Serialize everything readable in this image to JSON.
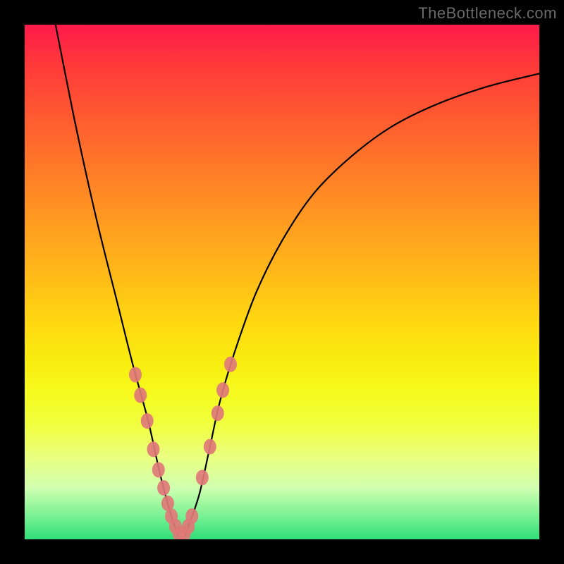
{
  "watermark": "TheBottleneck.com",
  "chart_data": {
    "type": "line",
    "title": "",
    "xlabel": "",
    "ylabel": "",
    "xlim": [
      0,
      100
    ],
    "ylim": [
      0,
      100
    ],
    "series": [
      {
        "name": "bottleneck-curve",
        "x": [
          6,
          10,
          14,
          18,
          21,
          24,
          26,
          27.5,
          29,
          30,
          31,
          32,
          34,
          36,
          38,
          41,
          45,
          50,
          56,
          63,
          71,
          80,
          90,
          100
        ],
        "y": [
          100,
          80,
          62,
          46,
          34,
          23,
          14,
          8,
          3,
          0.5,
          0.5,
          3,
          9,
          18,
          27,
          37,
          48,
          58,
          67,
          74,
          80,
          84.5,
          88,
          90.5
        ]
      }
    ],
    "markers": {
      "name": "highlighted-points",
      "color": "#e07878",
      "points_x": [
        21.5,
        22.5,
        23.8,
        25,
        26,
        27,
        27.8,
        28.5,
        29.3,
        30,
        31,
        31.8,
        32.5,
        34.5,
        36,
        37.5,
        38.5,
        40
      ],
      "points_y": [
        32,
        28,
        23,
        17.5,
        13.5,
        10,
        7,
        4.5,
        2.5,
        1,
        1,
        2.5,
        4.5,
        12,
        18,
        24.5,
        29,
        34
      ]
    }
  }
}
